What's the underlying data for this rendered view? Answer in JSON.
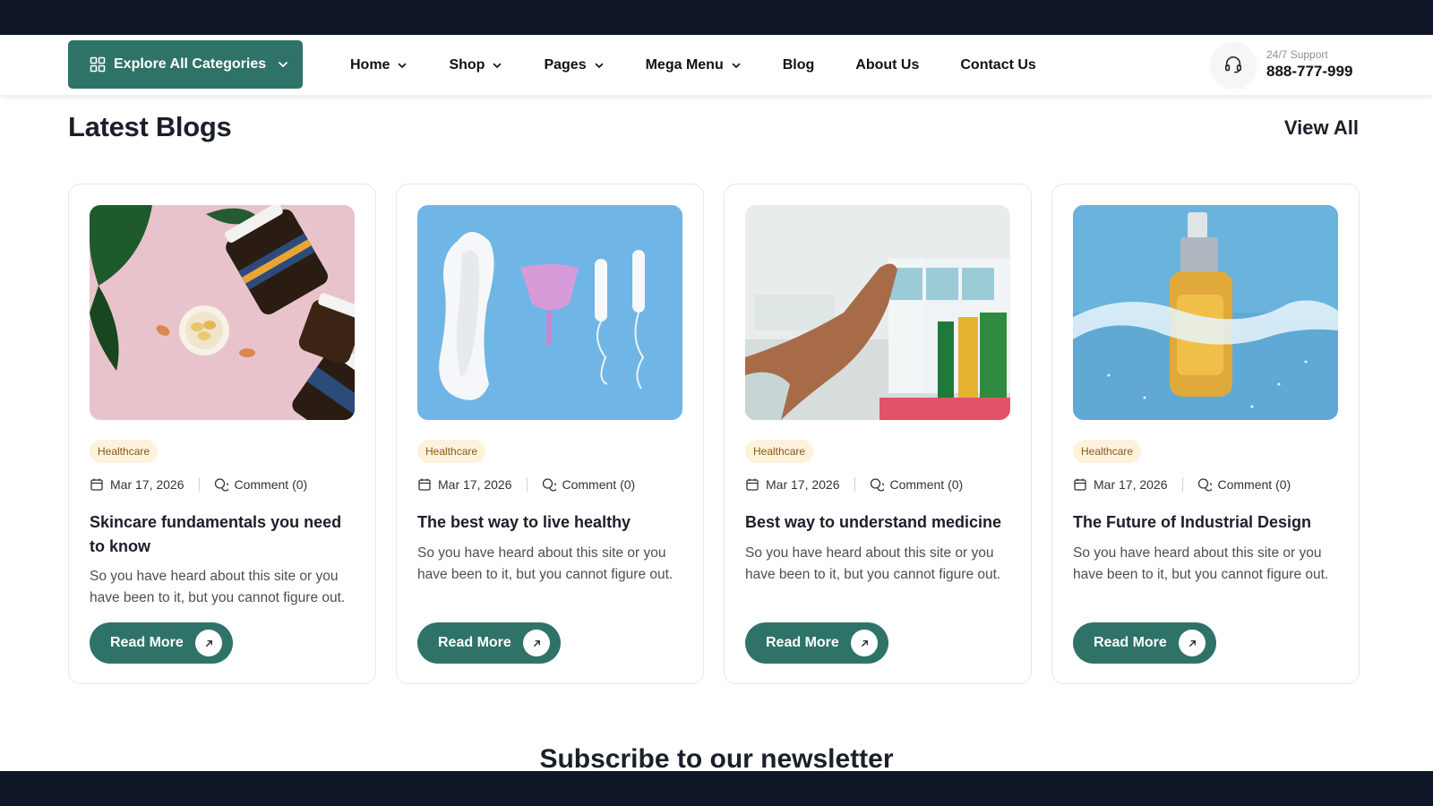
{
  "nav": {
    "explore_label": "Explore All Categories",
    "links": [
      {
        "label": "Home",
        "has_dropdown": true
      },
      {
        "label": "Shop",
        "has_dropdown": true
      },
      {
        "label": "Pages",
        "has_dropdown": true
      },
      {
        "label": "Mega Menu",
        "has_dropdown": true
      },
      {
        "label": "Blog",
        "has_dropdown": false
      },
      {
        "label": "About Us",
        "has_dropdown": false
      },
      {
        "label": "Contact Us",
        "has_dropdown": false
      }
    ],
    "support_label": "24/7 Support",
    "support_phone": "888-777-999"
  },
  "section": {
    "title": "Latest Blogs",
    "view_all": "View All"
  },
  "cards": [
    {
      "image_icon": "supplement-jars-photo",
      "tag": "Healthcare",
      "date": "Mar 17, 2026",
      "comments": "Comment (0)",
      "title": "Skincare fundamentals you need to know",
      "desc": "So you have heard about this site or you have been to it, but you cannot figure out.",
      "cta": "Read More"
    },
    {
      "image_icon": "feminine-care-photo",
      "tag": "Healthcare",
      "date": "Mar 17, 2026",
      "comments": "Comment (0)",
      "title": "The best way to live healthy",
      "desc": "So you have heard about this site or you have been to it, but you cannot figure out.",
      "cta": "Read More"
    },
    {
      "image_icon": "pharmacy-shelf-photo",
      "tag": "Healthcare",
      "date": "Mar 17, 2026",
      "comments": "Comment (0)",
      "title": "Best way to understand medicine",
      "desc": "So you have heard about this site or you have been to it, but you cannot figure out.",
      "cta": "Read More"
    },
    {
      "image_icon": "serum-bottle-photo",
      "tag": "Healthcare",
      "date": "Mar 17, 2026",
      "comments": "Comment (0)",
      "title": "The Future of Industrial Design",
      "desc": "So you have heard about this site or you have been to it, but you cannot figure out.",
      "cta": "Read More"
    }
  ],
  "newsletter": {
    "title": "Subscribe to our newsletter"
  },
  "colors": {
    "brand": "#2f7368",
    "dark_band": "#0e1628",
    "tag_bg": "#fdf2dc"
  }
}
